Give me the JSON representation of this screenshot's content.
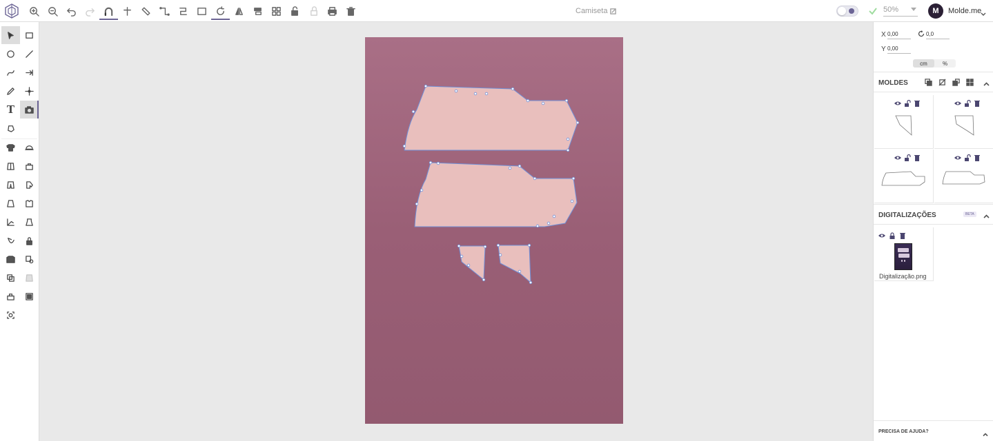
{
  "app": {
    "document_title": "Camiseta",
    "zoom_level": "50%",
    "user": {
      "initial": "M",
      "name": "Molde.me"
    }
  },
  "toolbar": {
    "tools": [
      {
        "name": "zoom-in-icon"
      },
      {
        "name": "zoom-out-icon"
      },
      {
        "name": "undo-icon"
      },
      {
        "name": "redo-icon"
      },
      {
        "name": "magnet-icon"
      },
      {
        "name": "guide-icon"
      },
      {
        "name": "ruler-icon"
      },
      {
        "name": "seam-allowance-icon"
      },
      {
        "name": "path-icon"
      },
      {
        "name": "rectangle-select-icon"
      },
      {
        "name": "rotate-icon"
      },
      {
        "name": "mirror-icon"
      },
      {
        "name": "align-icon"
      },
      {
        "name": "grid-icon"
      },
      {
        "name": "lock-icon"
      },
      {
        "name": "unlock-icon"
      },
      {
        "name": "print-icon"
      },
      {
        "name": "trash-icon"
      }
    ]
  },
  "transform": {
    "x_label": "X",
    "x_value": "0,00",
    "rotation_value": "0,0",
    "y_label": "Y",
    "y_value": "0,00",
    "unit_cm": "cm",
    "unit_percent": "%"
  },
  "molds_panel": {
    "title": "MOLDES",
    "items": [
      {
        "name": "piece-1"
      },
      {
        "name": "piece-2"
      },
      {
        "name": "piece-3"
      },
      {
        "name": "piece-4"
      }
    ]
  },
  "scans_panel": {
    "title": "DIGITALIZAÇÕES",
    "badge": "BETA",
    "file_name": "Digitalização.png"
  },
  "help": {
    "label": "PRECISA DE AJUDA?"
  },
  "colors": {
    "accent": "#6b6495",
    "board": "#a0667d",
    "piece_fill": "#e9bfbd",
    "outline": "#6f8fd8"
  }
}
